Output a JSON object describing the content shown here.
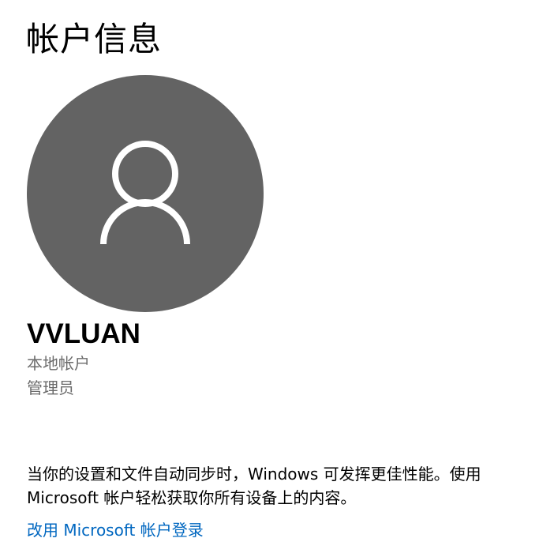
{
  "page": {
    "title": "帐户信息"
  },
  "user": {
    "name": "VVLUAN",
    "account_type": "本地帐户",
    "role": "管理员"
  },
  "avatar": {
    "icon": "person-icon",
    "background_color": "#636363",
    "icon_color": "#ffffff"
  },
  "sync": {
    "description": "当你的设置和文件自动同步时，Windows 可发挥更佳性能。使用 Microsoft 帐户轻松获取你所有设备上的内容。",
    "link_label": "改用 Microsoft 帐户登录",
    "link_color": "#0067c0"
  }
}
